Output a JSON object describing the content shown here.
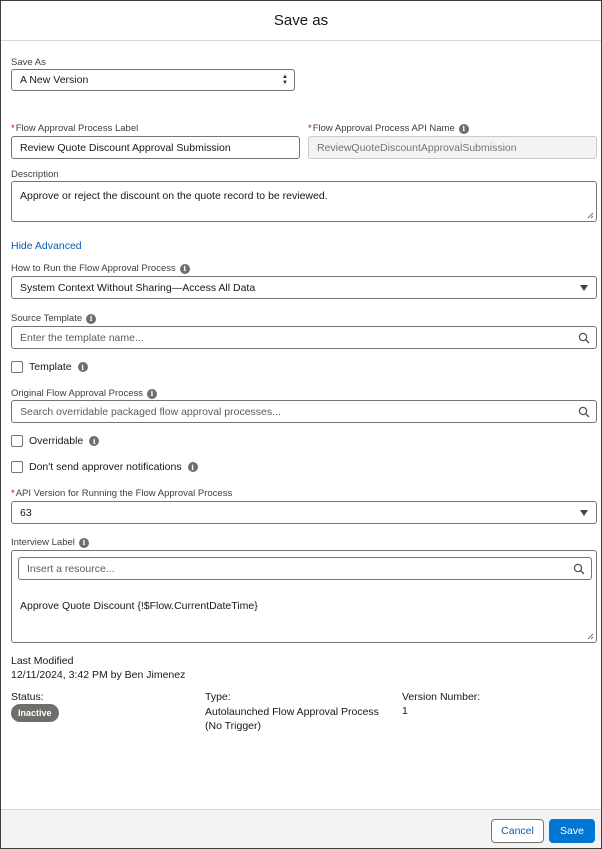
{
  "dialog": {
    "title": "Save as"
  },
  "save_as": {
    "label": "Save As",
    "value": "A New Version"
  },
  "label_field": {
    "label": "Flow Approval Process Label",
    "value": "Review Quote Discount Approval Submission"
  },
  "api_name_field": {
    "label": "Flow Approval Process API Name",
    "value": "ReviewQuoteDiscountApprovalSubmission"
  },
  "description": {
    "label": "Description",
    "value": "Approve or reject the discount on the quote record to be reviewed."
  },
  "hide_advanced": "Hide Advanced",
  "run_context": {
    "label": "How to Run the Flow Approval Process",
    "value": "System Context Without Sharing—Access All Data"
  },
  "source_template": {
    "label": "Source Template",
    "placeholder": "Enter the template name..."
  },
  "template_checkbox": {
    "label": "Template"
  },
  "original_process": {
    "label": "Original Flow Approval Process",
    "placeholder": "Search overridable packaged flow approval processes..."
  },
  "overridable_checkbox": {
    "label": "Overridable"
  },
  "notifications_checkbox": {
    "label": "Don't send approver notifications"
  },
  "api_version": {
    "label": "API Version for Running the Flow Approval Process",
    "value": "63"
  },
  "interview_label": {
    "label": "Interview Label",
    "placeholder": "Insert a resource...",
    "value": "Approve Quote Discount {!$Flow.CurrentDateTime}"
  },
  "last_modified": {
    "label": "Last Modified",
    "value": "12/11/2024, 3:42 PM by Ben Jimenez"
  },
  "status": {
    "label": "Status:",
    "value": "Inactive"
  },
  "type": {
    "label": "Type:",
    "value": "Autolaunched Flow Approval Process (No Trigger)"
  },
  "version": {
    "label": "Version Number:",
    "value": "1"
  },
  "footer": {
    "cancel": "Cancel",
    "save": "Save"
  },
  "colors": {
    "brand": "#0176d3",
    "link": "#0b5cab",
    "required": "#ba0517",
    "badge": "#706e6b"
  }
}
